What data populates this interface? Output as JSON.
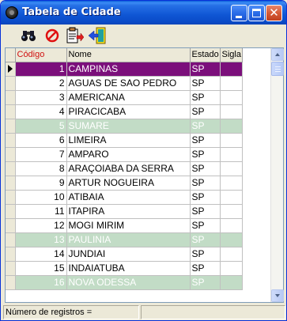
{
  "window": {
    "title": "Tabela de Cidade"
  },
  "toolbar": {
    "tools": [
      {
        "name": "find",
        "icon": "binoculars-icon"
      },
      {
        "name": "cancel",
        "icon": "no-entry-icon"
      },
      {
        "name": "report",
        "icon": "clipboard-arrow-icon"
      },
      {
        "name": "exit",
        "icon": "exit-door-icon"
      }
    ]
  },
  "grid": {
    "columns": [
      "Código",
      "Nome",
      "Estado",
      "Sigla"
    ],
    "rows": [
      {
        "codigo": "1",
        "nome": "CAMPINAS",
        "estado": "SP",
        "sigla": "",
        "state": "selected"
      },
      {
        "codigo": "2",
        "nome": "AGUAS DE SAO PEDRO",
        "estado": "SP",
        "sigla": "",
        "state": "normal"
      },
      {
        "codigo": "3",
        "nome": "AMERICANA",
        "estado": "SP",
        "sigla": "",
        "state": "normal"
      },
      {
        "codigo": "4",
        "nome": "PIRACICABA",
        "estado": "SP",
        "sigla": "",
        "state": "normal"
      },
      {
        "codigo": "5",
        "nome": "SUMARE",
        "estado": "SP",
        "sigla": "",
        "state": "inactive"
      },
      {
        "codigo": "6",
        "nome": "LIMEIRA",
        "estado": "SP",
        "sigla": "",
        "state": "normal"
      },
      {
        "codigo": "7",
        "nome": "AMPARO",
        "estado": "SP",
        "sigla": "",
        "state": "normal"
      },
      {
        "codigo": "8",
        "nome": "ARAÇOIABA DA SERRA",
        "estado": "SP",
        "sigla": "",
        "state": "normal"
      },
      {
        "codigo": "9",
        "nome": "ARTUR NOGUEIRA",
        "estado": "SP",
        "sigla": "",
        "state": "normal"
      },
      {
        "codigo": "10",
        "nome": "ATIBAIA",
        "estado": "SP",
        "sigla": "",
        "state": "normal"
      },
      {
        "codigo": "11",
        "nome": "ITAPIRA",
        "estado": "SP",
        "sigla": "",
        "state": "normal"
      },
      {
        "codigo": "12",
        "nome": "MOGI MIRIM",
        "estado": "SP",
        "sigla": "",
        "state": "normal"
      },
      {
        "codigo": "13",
        "nome": "PAULINIA",
        "estado": "SP",
        "sigla": "",
        "state": "inactive"
      },
      {
        "codigo": "14",
        "nome": "JUNDIAI",
        "estado": "SP",
        "sigla": "",
        "state": "normal"
      },
      {
        "codigo": "15",
        "nome": "INDAIATUBA",
        "estado": "SP",
        "sigla": "",
        "state": "normal"
      },
      {
        "codigo": "16",
        "nome": "NOVA ODESSA",
        "estado": "SP",
        "sigla": "",
        "state": "inactive"
      }
    ]
  },
  "statusbar": {
    "records_label": "Número de registros ="
  },
  "colors": {
    "selected_row": "#7b0f7b",
    "inactive_row": "#c2dcc6",
    "code_header": "#d01010",
    "titlebar": "#0a4ac7"
  }
}
